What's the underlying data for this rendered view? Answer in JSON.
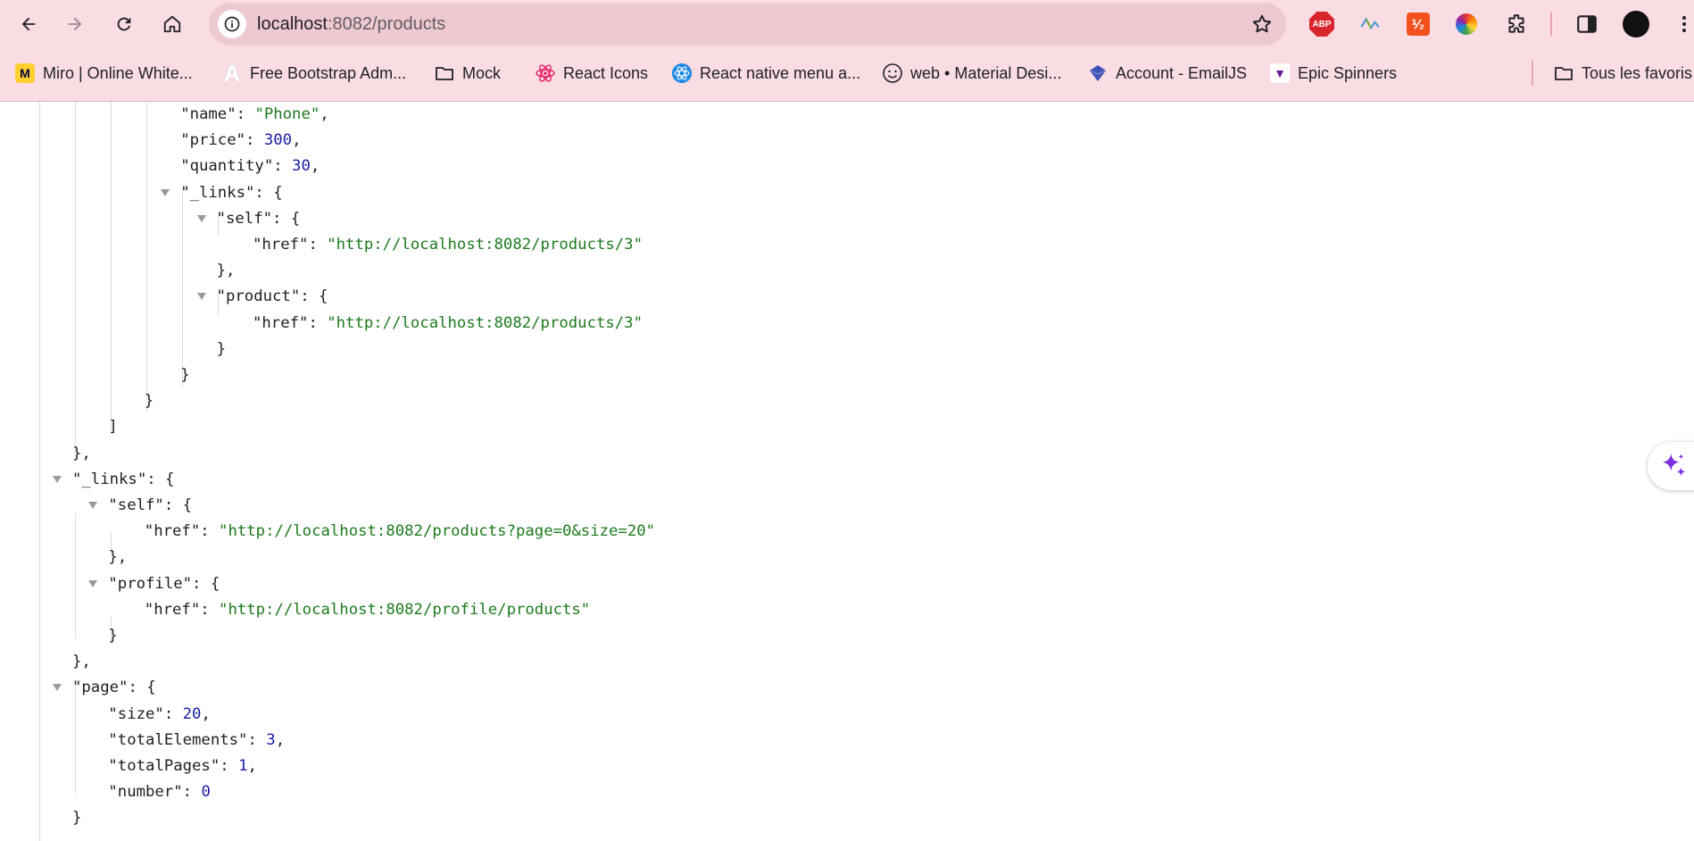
{
  "browser": {
    "url_host": "localhost",
    "url_path": ":8082/products",
    "bookmarks": [
      {
        "label": "Miro | Online White...",
        "icon": "miro-icon"
      },
      {
        "label": "Free Bootstrap Adm...",
        "icon": "bootstrap-admin-icon"
      },
      {
        "label": "Mock",
        "icon": "folder-icon"
      },
      {
        "label": "React Icons",
        "icon": "react-icon"
      },
      {
        "label": "React native menu a...",
        "icon": "react-native-icon"
      },
      {
        "label": "web • Material Desi...",
        "icon": "smiley-icon"
      },
      {
        "label": "Account - EmailJS",
        "icon": "emailjs-icon"
      },
      {
        "label": "Epic Spinners",
        "icon": "epic-spinners-icon"
      },
      {
        "label": "Tous les favoris",
        "icon": "folder-icon"
      }
    ],
    "extensions": [
      "adblock-plus-icon",
      "activity-icon",
      "orange-extension-icon",
      "color-picker-icon",
      "puzzle-extensions-icon",
      "side-panel-icon",
      "profile-avatar-icon"
    ],
    "abp_text": "ABP",
    "orange_ext_text": "⅟₂"
  },
  "json": {
    "lines": [
      "      \"name\": \"Phone\",",
      "      \"price\": 300,",
      "      \"quantity\": 30,",
      "      \"_links\": {",
      "        \"self\": {",
      "          \"href\": \"http://localhost:8082/products/3\"",
      "        },",
      "        \"product\": {",
      "          \"href\": \"http://localhost:8082/products/3\"",
      "        }",
      "      }",
      "    }",
      "  ]",
      "},",
      "\"_links\": {",
      "  \"self\": {",
      "    \"href\": \"http://localhost:8082/products?page=0&size=20\"",
      "  },",
      "  \"profile\": {",
      "    \"href\": \"http://localhost:8082/profile/products\"",
      "  }",
      "},",
      "\"page\": {",
      "  \"size\": 20,",
      "  \"totalElements\": 3,",
      "  \"totalPages\": 1,",
      "  \"number\": 0",
      "}"
    ]
  }
}
